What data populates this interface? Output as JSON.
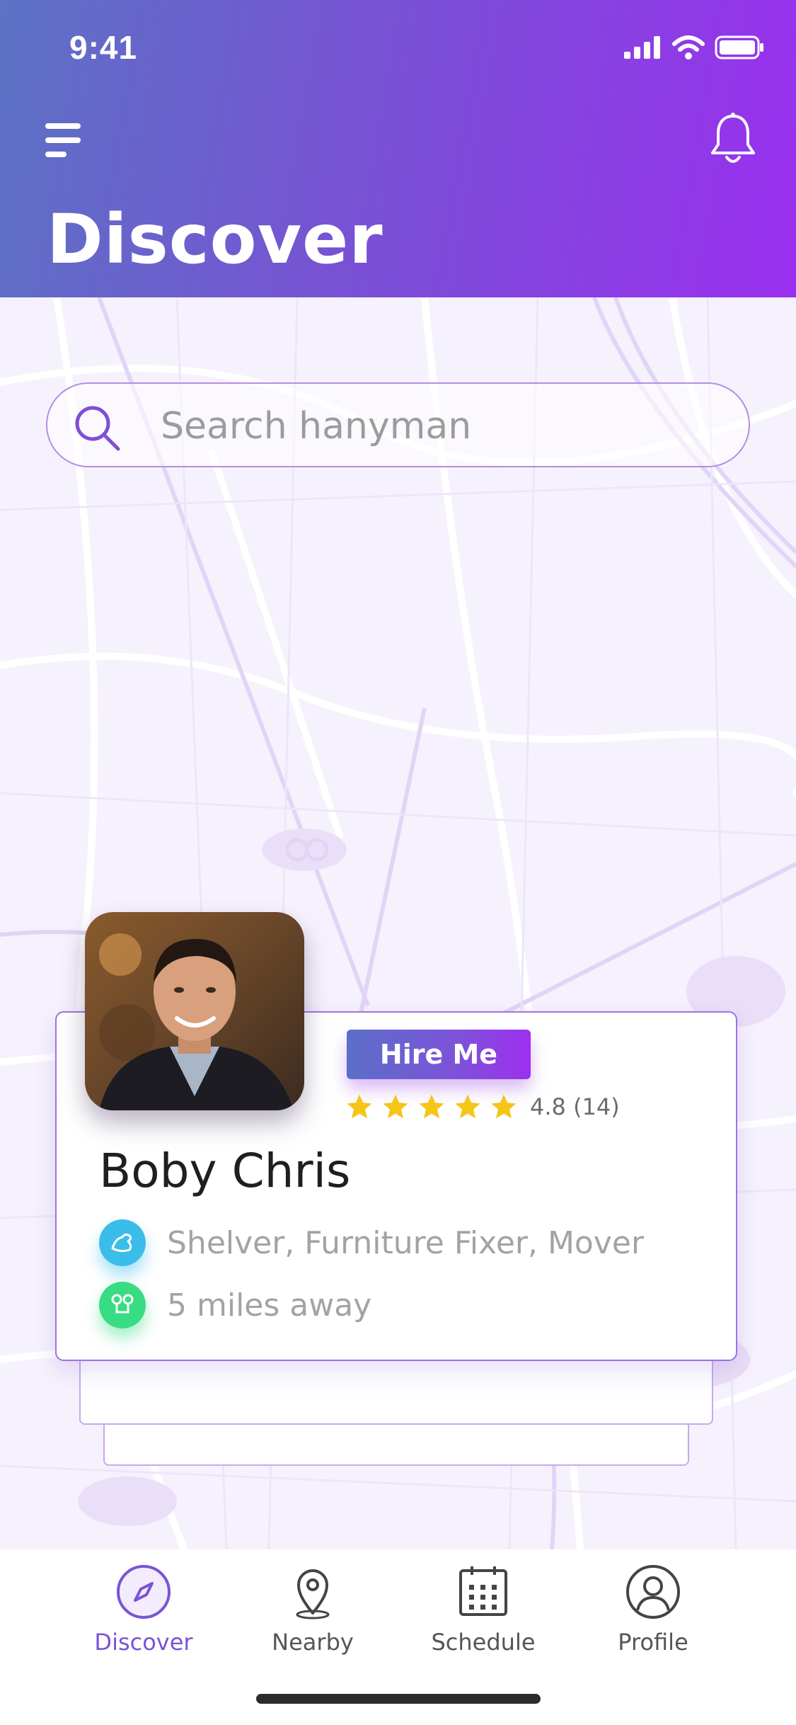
{
  "status_bar": {
    "time": "9:41"
  },
  "header": {
    "title": "Discover"
  },
  "search": {
    "placeholder": "Search hanyman",
    "value": ""
  },
  "provider": {
    "name": "Boby Chris",
    "hire_label": "Hire Me",
    "rating": 4.8,
    "rating_text": "4.8 (14)",
    "stars": 5,
    "services": "Shelver, Furniture Fixer, Mover",
    "distance": "5 miles away"
  },
  "tabs": [
    {
      "label": "Discover",
      "icon": "compass-icon",
      "active": true
    },
    {
      "label": "Nearby",
      "icon": "location-pin-icon",
      "active": false
    },
    {
      "label": "Schedule",
      "icon": "calendar-icon",
      "active": false
    },
    {
      "label": "Profile",
      "icon": "user-icon",
      "active": false
    }
  ],
  "colors": {
    "gradient_start": "#5c72c4",
    "gradient_end": "#9a2ff0",
    "accent": "#7b53d6",
    "star": "#f5c518",
    "service_icon": "#3bbde9",
    "distance_icon": "#38dc83"
  }
}
